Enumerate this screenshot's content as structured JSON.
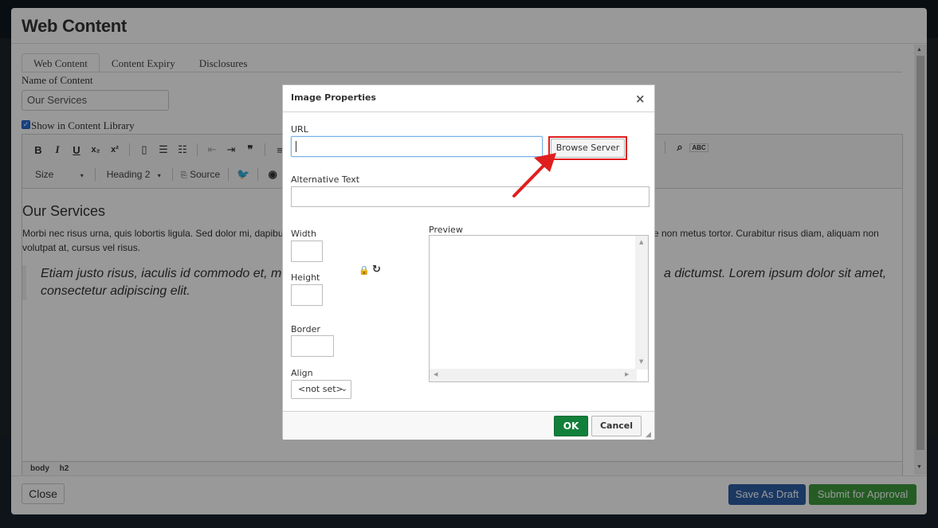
{
  "outer": {
    "title": "Web Content",
    "tabs": [
      "Web Content",
      "Content Expiry",
      "Disclosures"
    ],
    "name_label": "Name of Content",
    "name_value": "Our Services",
    "library_label": "Show in Content Library",
    "library_checked": true
  },
  "editor": {
    "size_combo": "Size",
    "format_combo": "Heading 2",
    "source_label": "Source",
    "heading": "Our Services",
    "paragraph": "Morbi nec risus urna, quis lobortis ligula. Sed dolor mi, dapibus",
    "paragraph_right": "ce non metus tortor. Curabitur risus diam, aliquam non",
    "paragraph_line2": "volutpat at, cursus vel risus.",
    "quote_left": "Etiam justo risus, iaculis id commodo et, mo",
    "quote_right": "a dictumst. Lorem ipsum dolor sit amet,",
    "quote_line2": "consectetur adipiscing elit.",
    "path": [
      "body",
      "h2"
    ]
  },
  "footer": {
    "close_label": "Close",
    "draft_label": "Save As Draft",
    "approve_label": "Submit for Approval"
  },
  "dialog": {
    "title": "Image Properties",
    "close_glyph": "×",
    "url_label": "URL",
    "url_value": "",
    "browse_label": "Browse Server",
    "alt_label": "Alternative Text",
    "width_label": "Width",
    "height_label": "Height",
    "border_label": "Border",
    "align_label": "Align",
    "align_value": "<not set>",
    "preview_label": "Preview",
    "ok_label": "OK",
    "cancel_label": "Cancel"
  },
  "colors": {
    "highlight": "#e01e1e",
    "ok": "#12803a",
    "draft": "#2c5ea3",
    "approve": "#3c9a3c"
  }
}
